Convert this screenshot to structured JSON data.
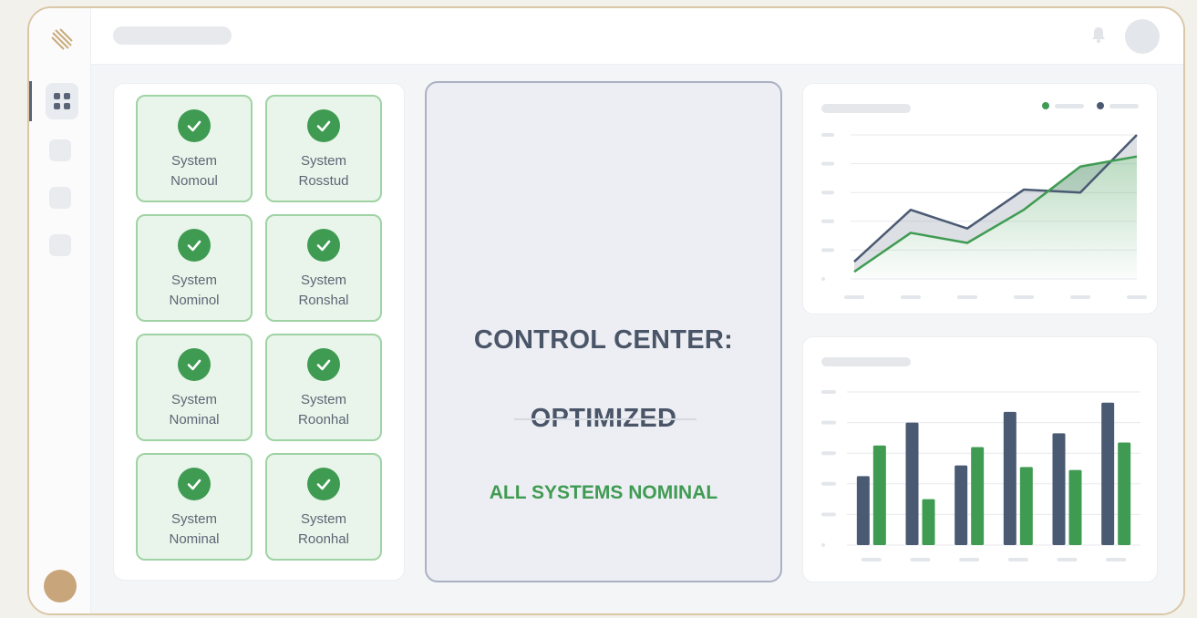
{
  "app": {
    "accent_green": "#3f9b52",
    "accent_navy": "#4b5a73"
  },
  "sidebar": {
    "logo_icon": "striped-logo-icon",
    "items": [
      {
        "icon": "grid-icon",
        "active": true
      },
      {
        "icon": "square-icon",
        "active": false
      },
      {
        "icon": "square-icon",
        "active": false
      },
      {
        "icon": "square-icon",
        "active": false
      }
    ]
  },
  "topbar": {
    "notification_icon": "bell-icon"
  },
  "tiles": [
    {
      "line1": "System",
      "line2": "Nomoul"
    },
    {
      "line1": "System",
      "line2": "Rosstud"
    },
    {
      "line1": "System",
      "line2": "Nominol"
    },
    {
      "line1": "System",
      "line2": "Ronshal"
    },
    {
      "line1": "System",
      "line2": "Nominal"
    },
    {
      "line1": "System",
      "line2": "Roonhal"
    },
    {
      "line1": "System",
      "line2": "Nominal"
    },
    {
      "line1": "System",
      "line2": "Roonhal"
    }
  ],
  "center": {
    "title_line1": "CONTROL CENTER:",
    "title_line2": "OPTIMIZED",
    "subtitle": "ALL SYSTEMS NOMINAL"
  },
  "chart_data": [
    {
      "type": "area",
      "series": [
        {
          "color": "#4b5a73",
          "values": [
            12,
            48,
            35,
            62,
            60,
            100
          ]
        },
        {
          "color": "#3f9b52",
          "values": [
            5,
            32,
            25,
            48,
            78,
            85
          ]
        }
      ],
      "ylim": [
        0,
        100
      ],
      "grid": true,
      "legend": "top-right"
    },
    {
      "type": "bar",
      "series": [
        {
          "color": "#4b5a73",
          "values": [
            45,
            80,
            52,
            87,
            73,
            93
          ]
        },
        {
          "color": "#3f9b52",
          "values": [
            65,
            30,
            64,
            51,
            49,
            67
          ]
        }
      ],
      "ylim": [
        0,
        100
      ],
      "grid": true
    }
  ]
}
